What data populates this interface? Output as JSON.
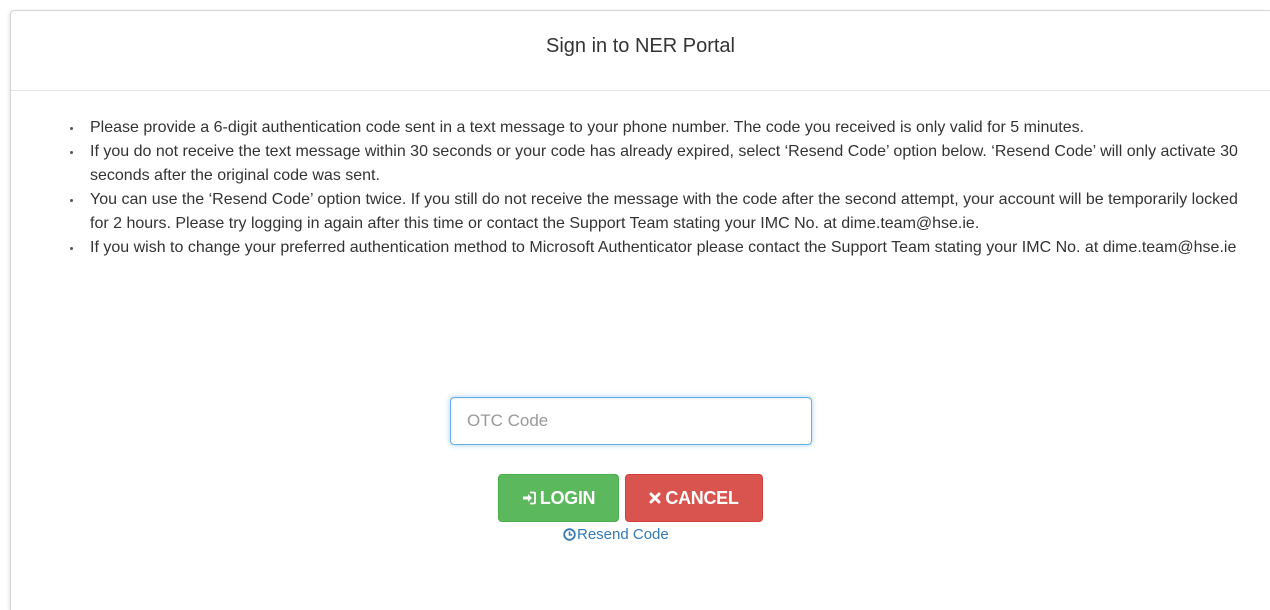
{
  "header": {
    "title": "Sign in to NER Portal"
  },
  "instructions": [
    "Please provide a 6-digit authentication code sent in a text message to your phone number. The code you received is only valid for 5 minutes.",
    "If you do not receive the text message within 30 seconds or your code has already expired, select ‘Resend Code’ option below. ‘Resend Code’ will only activate 30 seconds after the original code was sent.",
    "You can use the ‘Resend Code’ option twice. If you still do not receive the message with the code after the second attempt, your account will be temporarily locked for 2 hours. Please try logging in again after this time or contact the Support Team stating your IMC No. at dime.team@hse.ie.",
    "If you wish to change your preferred authentication method to Microsoft Authenticator please contact the Support Team stating your IMC No. at dime.team@hse.ie"
  ],
  "form": {
    "otc_placeholder": "OTC Code",
    "otc_value": ""
  },
  "buttons": {
    "login_label": "LOGIN",
    "login_icon": "sign-in-icon",
    "cancel_label": "CANCEL",
    "cancel_icon": "close-icon"
  },
  "resend": {
    "label": "Resend Code",
    "icon": "clock-icon"
  },
  "colors": {
    "login": "#5cb85c",
    "cancel": "#d9534f",
    "link": "#337ab7",
    "input_focus": "#66afe9"
  }
}
